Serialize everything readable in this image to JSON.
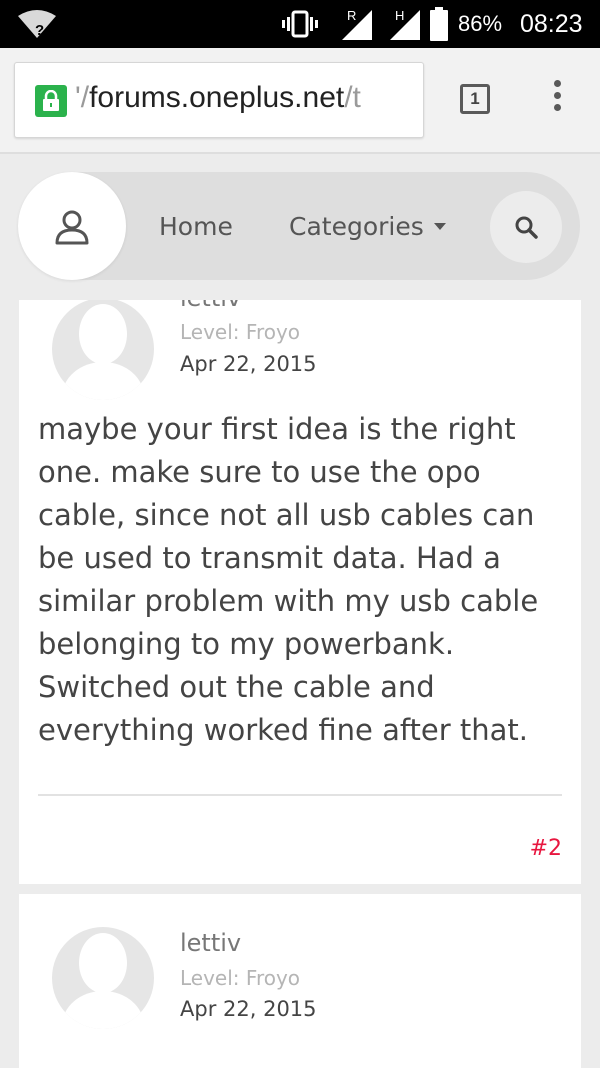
{
  "status_bar": {
    "wifi_icon": "wifi-question-icon",
    "signal_labels": [
      "R",
      "H"
    ],
    "battery_percent": "86%",
    "time": "08:23"
  },
  "browser": {
    "url_prefix": "'/",
    "url_domain": "forums.oneplus.net",
    "url_suffix": "/t",
    "tab_count": "1"
  },
  "nav": {
    "home_label": "Home",
    "categories_label": "Categories"
  },
  "posts": [
    {
      "username": "lettiv",
      "level": "Level: Froyo",
      "date": "Apr 22, 2015",
      "body": "maybe your first idea is the right one. make sure to use the opo cable, since not all usb cables can be used to transmit data. Had a similar problem with my usb cable belonging to my powerbank. Switched out the cable and everything worked fine after that.",
      "number": "#2"
    },
    {
      "username": "lettiv",
      "level": "Level: Froyo",
      "date": "Apr 22, 2015"
    }
  ],
  "colors": {
    "accent": "#e8163f",
    "lock_green": "#2bb24c"
  }
}
